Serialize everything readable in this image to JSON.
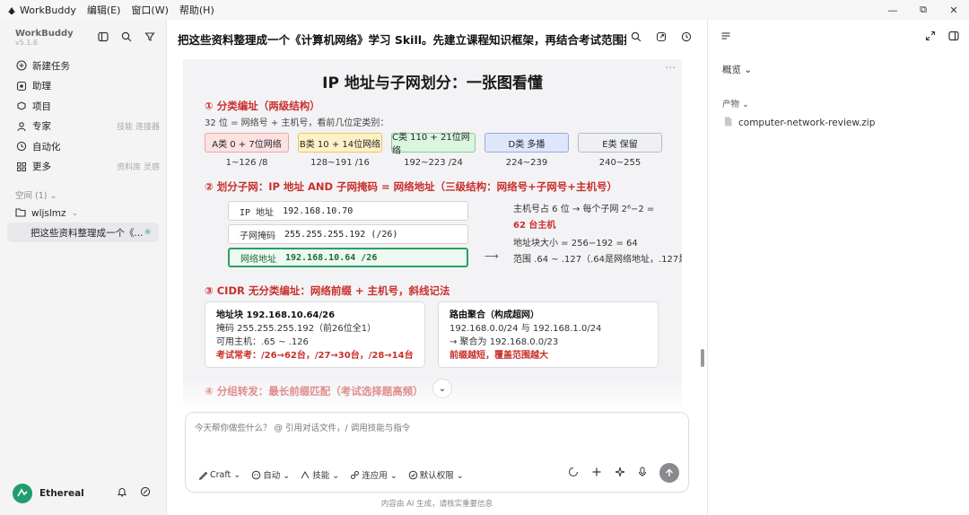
{
  "titlebar": {
    "app_name": "WorkBuddy",
    "menu": [
      "编辑(E)",
      "窗口(W)",
      "帮助(H)"
    ],
    "controls": [
      "—",
      "⧉",
      "✕"
    ]
  },
  "sidebar": {
    "brand": "WorkBuddy",
    "version": "v5.1.6",
    "nav": [
      {
        "label": "新建任务",
        "icon": "plus-circle-icon",
        "meta": ""
      },
      {
        "label": "助理",
        "icon": "assistant-icon",
        "meta": ""
      },
      {
        "label": "项目",
        "icon": "project-icon",
        "meta": ""
      },
      {
        "label": "专家",
        "icon": "expert-icon",
        "meta": "技能 连接器"
      },
      {
        "label": "自动化",
        "icon": "clock-icon",
        "meta": ""
      },
      {
        "label": "更多",
        "icon": "grid-icon",
        "meta": "资料库 灵感"
      }
    ],
    "space_label": "空间 (1) ⌄",
    "workspace": "wljslmz",
    "chat_item": "把这些资料整理成一个《...",
    "user": "Ethereal"
  },
  "main": {
    "header": "把这些资料整理成一个《计算机网络》学习 Skill。先建立课程知识框架，再结合考试范围提炼重...",
    "doc": {
      "title": "IP 地址与子网划分：一张图看懂",
      "sec1": "① 分类编址（两级结构）",
      "sec1_note": "32 位 = 网络号 + 主机号，看前几位定类别：",
      "classes": [
        {
          "label": "A类 0 + 7位网络",
          "range": "1~126 /8"
        },
        {
          "label": "B类 10 + 14位网络",
          "range": "128~191 /16"
        },
        {
          "label": "C类 110 + 21位网络",
          "range": "192~223 /24"
        },
        {
          "label": "D类 多播",
          "range": "224~239"
        },
        {
          "label": "E类 保留",
          "range": "240~255"
        }
      ],
      "sec2": "② 划分子网：IP 地址 AND 子网掩码 = 网络地址（三级结构：网络号+子网号+主机号）",
      "ip_rows": [
        {
          "label": "IP 地址",
          "value": "192.168.10.70"
        },
        {
          "label": "子网掩码",
          "value": "255.255.255.192 (/26)"
        },
        {
          "label": "网络地址",
          "value": "192.168.10.64 /26"
        }
      ],
      "notes": {
        "host_bits": "主机号占 6 位 → 每个子网 2⁶−2 =",
        "hosts": "62 台主机",
        "block": "地址块大小 = 256−192 = 64",
        "range": "范围 .64 ~ .127（.64是网络地址，.127是"
      },
      "arrow": "⟶",
      "sec3": "③ CIDR 无分类编址：网络前缀 + 主机号，斜线记法",
      "card1": {
        "title": "地址块 192.168.10.64/26",
        "line1": "掩码 255.255.255.192（前26位全1）",
        "line2": "可用主机：.65 ~ .126",
        "tip": "考试常考：/26→62台，/27→30台，/28→14台"
      },
      "card2": {
        "title": "路由聚合（构成超网）",
        "line1": "192.168.0.0/24 与 192.168.1.0/24",
        "line2": "→ 聚合为 192.168.0.0/23",
        "tip": "前缀越短，覆盖范围越大"
      },
      "sec4": "④ 分组转发：最长前缀匹配（考试选择题高频）",
      "dots": "⋯"
    },
    "input": {
      "placeholder": "今天帮你做些什么？ @ 引用对话文件，/ 调用技能与指令",
      "tools": [
        "Craft ⌄",
        "自动 ⌄",
        "技能 ⌄",
        "连应用 ⌄",
        "默认权限 ⌄"
      ]
    },
    "footnote": "内容由 AI 生成，请核实重要信息"
  },
  "panel": {
    "overview": "概览 ⌄",
    "artifacts": "产物 ⌄",
    "file": "computer-network-review.zip"
  },
  "colors": {
    "accent_red": "#c9302c",
    "green": "#27a160",
    "class_a": "#fde2e2",
    "class_b": "#fff1c6",
    "class_c": "#dcf5df",
    "class_d": "#dfe6fb",
    "class_e": "#eef0f4"
  }
}
